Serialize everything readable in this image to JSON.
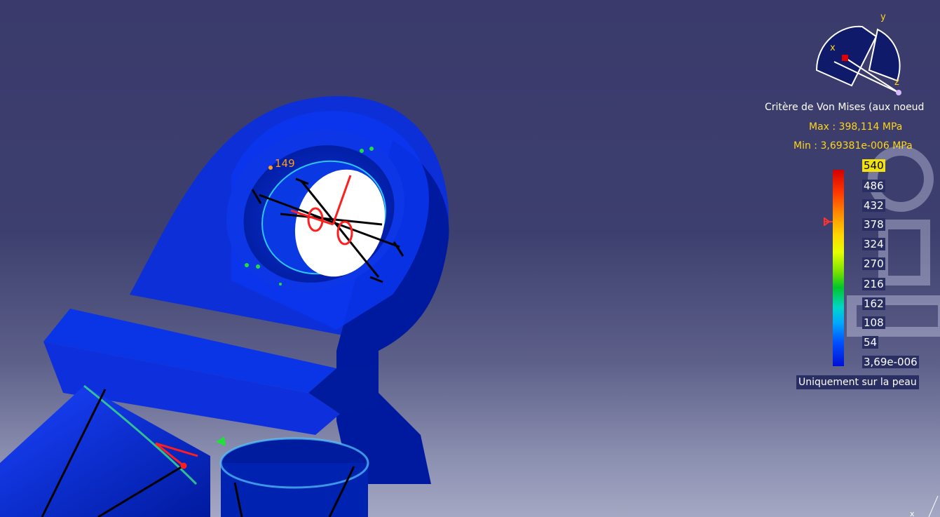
{
  "legend": {
    "title": "Critère de Von Mises (aux noeud",
    "max": "Max : 398,114 MPa",
    "min": "Min : 3,69381e-006 MPa",
    "ticks": [
      "540",
      "486",
      "432",
      "378",
      "324",
      "270",
      "216",
      "162",
      "108",
      "54",
      "3,69e-006"
    ],
    "filter_label": "Uniquement sur la peau"
  },
  "node_label": "149",
  "compass": {
    "x": "x",
    "y": "y",
    "z": "z"
  },
  "axis_corner": {
    "x": "x"
  },
  "colors": {
    "background_top": "#3a3b6c",
    "background_bottom": "#a4a8c3",
    "part_blue": "#0a2fd0",
    "highlight_yellow": "#ffd51a",
    "load_red": "#ff1e1e",
    "constraint_green": "#22e03a"
  }
}
